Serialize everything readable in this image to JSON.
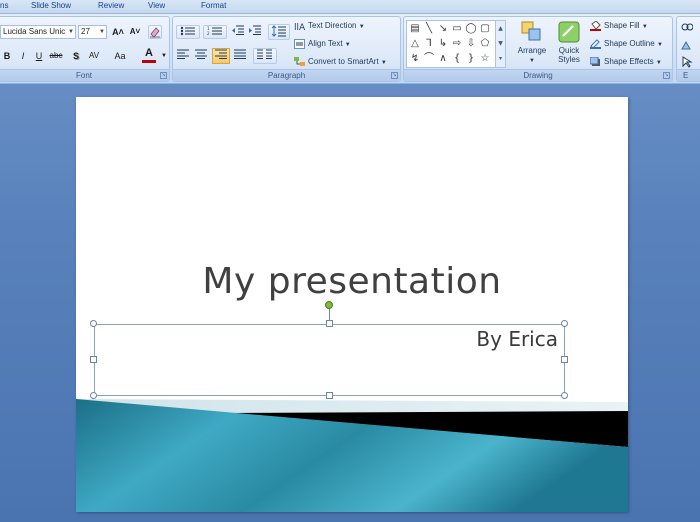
{
  "tabs": [
    "ns",
    "Slide Show",
    "Review",
    "View",
    "Format"
  ],
  "font": {
    "name": "Lucida Sans Unic",
    "size": "27",
    "grow": "A˄",
    "shrink": "A˅",
    "bold": "B",
    "italic": "I",
    "underline": "U",
    "strike": "abc",
    "shadow": "S",
    "spacing": "AV",
    "case": "Aa",
    "color_glyph": "A",
    "label": "Font"
  },
  "paragraph": {
    "text_direction": "Text Direction",
    "align_text": "Align Text",
    "convert_smartart": "Convert to SmartArt",
    "label": "Paragraph"
  },
  "drawing": {
    "arrange": "Arrange",
    "quick_styles": "Quick Styles",
    "shape_fill": "Shape Fill",
    "shape_outline": "Shape Outline",
    "shape_effects": "Shape Effects",
    "label": "Drawing"
  },
  "editing": {
    "label": "E"
  },
  "slide": {
    "title": "My presentation",
    "subtitle": "By Erica"
  },
  "colors": {
    "accent_teal": "#2a8aa3",
    "dark_band": "#000000",
    "font_color_bar": "#c00000"
  }
}
